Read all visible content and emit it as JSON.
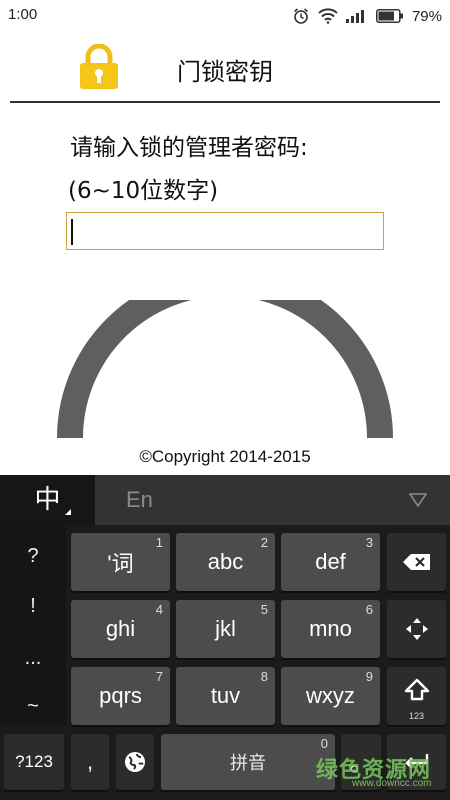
{
  "status_bar": {
    "time": "1:00",
    "battery": "79%",
    "icons": [
      "alarm-icon",
      "wifi-icon",
      "signal-icon",
      "battery-icon"
    ]
  },
  "app": {
    "title": "门锁密钥",
    "icon": "lock-icon",
    "accent_color": "#f5c518"
  },
  "form": {
    "prompt_line1": "请输入锁的管理者密码:",
    "prompt_line2": "(6~10位数字)",
    "password_value": "",
    "input_border_color": "#c9a23c"
  },
  "footer": {
    "copyright": "©Copyright 2014-2015"
  },
  "keyboard": {
    "mode_active": "中",
    "mode_inactive": "En",
    "collapse_icon": "triangle-down-icon",
    "side_symbols": [
      "?",
      "!",
      "...",
      "~"
    ],
    "rows": [
      [
        {
          "label": "'词",
          "num": "1"
        },
        {
          "label": "abc",
          "num": "2"
        },
        {
          "label": "def",
          "num": "3"
        }
      ],
      [
        {
          "label": "ghi",
          "num": "4"
        },
        {
          "label": "jkl",
          "num": "5"
        },
        {
          "label": "mno",
          "num": "6"
        }
      ],
      [
        {
          "label": "pqrs",
          "num": "7"
        },
        {
          "label": "tuv",
          "num": "8"
        },
        {
          "label": "wxyz",
          "num": "9"
        }
      ]
    ],
    "right_keys": {
      "backspace_icon": "backspace-icon",
      "cursor_icon": "cursor-move-icon",
      "shift_icon": "shift-arrow-icon",
      "shift_sub": "123",
      "enter_icon": "enter-arrow-icon"
    },
    "bottom_row": {
      "numeric_label": "?123",
      "comma_label": ",",
      "globe_icon": "globe-icon",
      "space_label": "拼音",
      "space_num": "0",
      "period_label": "。"
    }
  },
  "watermark": {
    "text": "绿色资源网",
    "url": "www.downcc.com"
  }
}
